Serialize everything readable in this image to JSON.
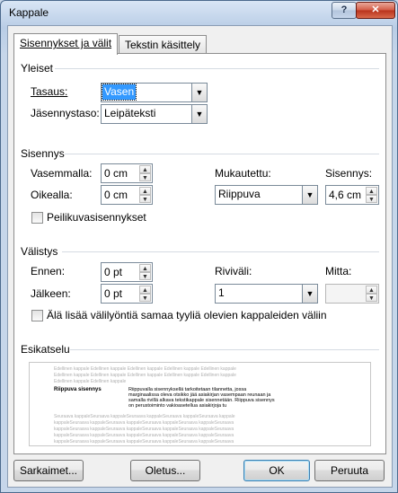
{
  "window": {
    "title": "Kappale",
    "help_label": "?",
    "close_label": "✕"
  },
  "tabs": [
    {
      "label": "Sisennykset ja välit",
      "active": true
    },
    {
      "label": "Tekstin käsittely",
      "active": false
    }
  ],
  "general": {
    "title": "Yleiset",
    "alignment_label": "Tasaus:",
    "alignment_value": "Vasen",
    "outline_label": "Jäsennystaso:",
    "outline_value": "Leipäteksti"
  },
  "indent": {
    "title": "Sisennys",
    "left_label": "Vasemmalla:",
    "left_value": "0 cm",
    "right_label": "Oikealla:",
    "right_value": "0 cm",
    "special_label": "Mukautettu:",
    "special_value": "Riippuva",
    "by_label": "Sisennys:",
    "by_value": "4,6 cm",
    "mirror_label": "Peilikuvasisennykset"
  },
  "spacing": {
    "title": "Välistys",
    "before_label": "Ennen:",
    "before_value": "0 pt",
    "after_label": "Jälkeen:",
    "after_value": "0 pt",
    "line_label": "Riviväli:",
    "line_value": "1",
    "at_label": "Mitta:",
    "at_value": "",
    "no_space_label": "Älä lisää välilyöntiä samaa tyyliä olevien kappaleiden väliin"
  },
  "preview": {
    "title": "Esikatselu",
    "prev_lines": [
      "Edellinen kappale Edellinen kappale Edellinen kappale Edellinen kappale Edellinen kappale",
      "Edellinen kappale Edellinen kappale Edellinen kappale Edellinen kappale Edellinen kappale",
      "Edellinen kappale Edellinen kappale"
    ],
    "sample_head": "Riippuva sisennys",
    "sample_text": "Riippuvalla sisennyksellä tarkoitetaan tilannetta, jossa marginaalissa oleva otsikko jää asiakirjan vasempaan reunaan ja samalla rivillä alkava tekstikappale sisennetään. Riippuva sisennys on perustoiminto vakioasetellua asiakirjoja tu",
    "next_lines": [
      "Seuraava kappaleSeuraava kappaleSeuraava kappaleSeuraava kappaleSeuraava kappale",
      "kappaleSeuraava kappaleSeuraava kappaleSeuraava kappaleSeuraava kappaleSeuraava",
      "kappaleSeuraava kappaleSeuraava kappaleSeuraava kappaleSeuraava kappaleSeuraava",
      "kappaleSeuraava kappaleSeuraava kappaleSeuraava kappaleSeuraava kappaleSeuraava",
      "kappaleSeuraava kappaleSeuraava kappaleSeuraava kappaleSeuraava kappaleSeuraava"
    ]
  },
  "buttons": {
    "tabs_label": "Sarkaimet...",
    "default_label": "Oletus...",
    "ok_label": "OK",
    "cancel_label": "Peruuta"
  }
}
